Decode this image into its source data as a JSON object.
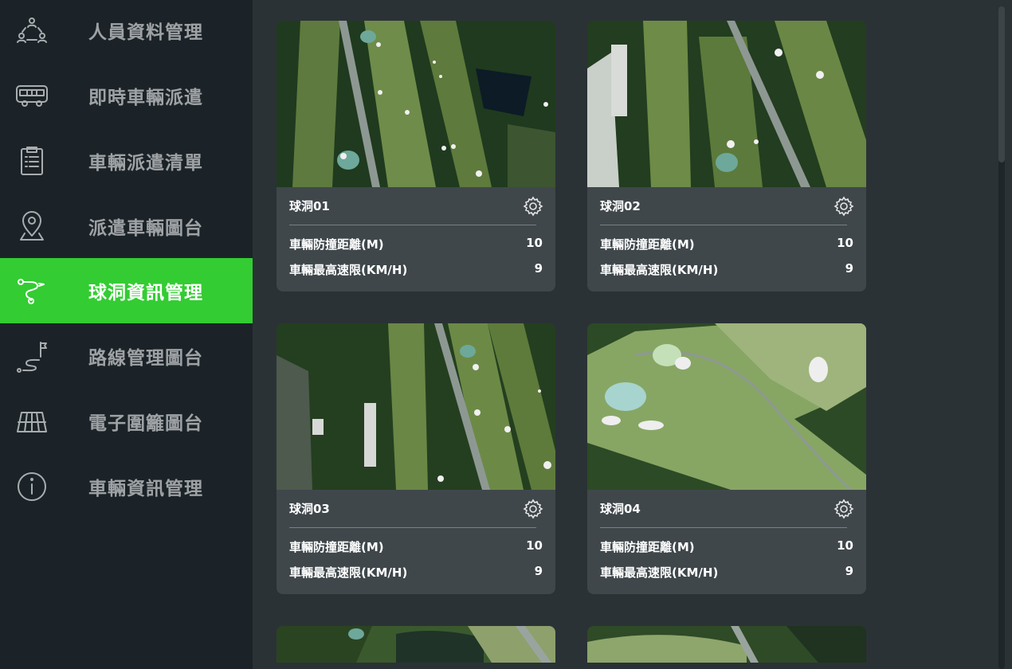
{
  "sidebar": {
    "items": [
      {
        "label": "人員資料管理",
        "icon": "people-network-icon",
        "active": false
      },
      {
        "label": "即時車輛派遣",
        "icon": "bus-icon",
        "active": false
      },
      {
        "label": "車輛派遣清單",
        "icon": "clipboard-list-icon",
        "active": false
      },
      {
        "label": "派遣車輛圖台",
        "icon": "map-pin-icon",
        "active": false
      },
      {
        "label": "球洞資訊管理",
        "icon": "golf-route-icon",
        "active": true
      },
      {
        "label": "路線管理圖台",
        "icon": "route-flag-icon",
        "active": false
      },
      {
        "label": "電子圍籬圖台",
        "icon": "fence-grid-icon",
        "active": false
      },
      {
        "label": "車輛資訊管理",
        "icon": "info-circle-icon",
        "active": false
      }
    ],
    "active_color": "#33cc33"
  },
  "holes": [
    {
      "name": "球洞01",
      "rows": [
        {
          "label": "車輛防撞距離(M)",
          "value": "10"
        },
        {
          "label": "車輛最高速限(KM/H)",
          "value": "9"
        }
      ]
    },
    {
      "name": "球洞02",
      "rows": [
        {
          "label": "車輛防撞距離(M)",
          "value": "10"
        },
        {
          "label": "車輛最高速限(KM/H)",
          "value": "9"
        }
      ]
    },
    {
      "name": "球洞03",
      "rows": [
        {
          "label": "車輛防撞距離(M)",
          "value": "10"
        },
        {
          "label": "車輛最高速限(KM/H)",
          "value": "9"
        }
      ]
    },
    {
      "name": "球洞04",
      "rows": [
        {
          "label": "車輛防撞距離(M)",
          "value": "10"
        },
        {
          "label": "車輛最高速限(KM/H)",
          "value": "9"
        }
      ]
    }
  ]
}
